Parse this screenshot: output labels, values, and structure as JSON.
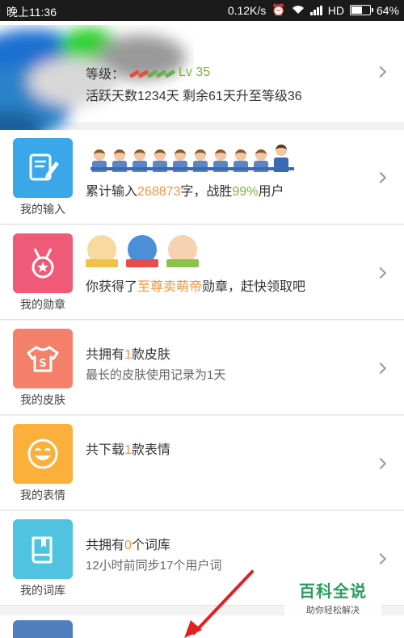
{
  "status_bar": {
    "time": "晚上11:36",
    "speed": "0.12K/s",
    "network": "HD",
    "battery_text": "64%",
    "battery_level": 0.64
  },
  "profile": {
    "level_prefix": "等级：",
    "level_value": "Lv 35",
    "active_line": "活跃天数1234天  剩余61天升至等级36"
  },
  "rows": [
    {
      "label": "我的输入",
      "title_parts": [
        "累计输入",
        "268873",
        "字，战胜",
        "99%",
        "用户"
      ],
      "icon": "note-pen-icon",
      "color": "#3aa8e8"
    },
    {
      "label": "我的勋章",
      "title_parts": [
        "你获得了",
        "至尊卖萌帝",
        "勋章，赶快领取吧"
      ],
      "icon": "medal-star-icon",
      "color": "#ef5a78"
    },
    {
      "label": "我的皮肤",
      "title_parts": [
        "共拥有",
        "1",
        "款皮肤"
      ],
      "sub": "最长的皮肤使用记录为1天",
      "icon": "tshirt-icon",
      "color": "#f4806a"
    },
    {
      "label": "我的表情",
      "title_parts": [
        "共下载",
        "1",
        "款表情"
      ],
      "icon": "smiley-icon",
      "color": "#fbb03b"
    },
    {
      "label": "我的词库",
      "title_parts": [
        "共拥有",
        "0",
        "个词库"
      ],
      "sub": "12小时前同步17个用户词",
      "icon": "book-icon",
      "color": "#4fc3e0"
    }
  ],
  "watermark": {
    "title": "百科全说",
    "subtitle": "助你轻松解决"
  },
  "colors": {
    "highlight_orange": "#f7933a",
    "highlight_green": "#7cb33a",
    "arrow_red": "#e32020"
  }
}
